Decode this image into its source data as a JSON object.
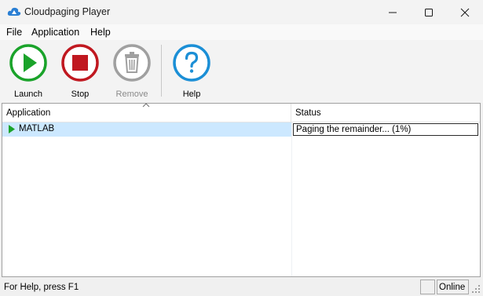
{
  "window": {
    "title": "Cloudpaging Player"
  },
  "menu": {
    "file": "File",
    "application": "Application",
    "help": "Help"
  },
  "toolbar": {
    "launch": {
      "label": "Launch",
      "icon": "play-circle-icon",
      "color": "#1aa32a",
      "enabled": true
    },
    "stop": {
      "label": "Stop",
      "icon": "stop-circle-icon",
      "color": "#c01820",
      "enabled": true
    },
    "remove": {
      "label": "Remove",
      "icon": "trash-circle-icon",
      "color": "#a0a0a0",
      "enabled": false
    },
    "help": {
      "label": "Help",
      "icon": "question-circle-icon",
      "color": "#1b8fd6",
      "enabled": true
    }
  },
  "list": {
    "columns": {
      "application": "Application",
      "status": "Status"
    },
    "rows": [
      {
        "application": "MATLAB",
        "status": "Paging the remainder... (1%)",
        "selected": true
      }
    ]
  },
  "statusbar": {
    "help_text": "For Help, press F1",
    "connection": "Online"
  }
}
